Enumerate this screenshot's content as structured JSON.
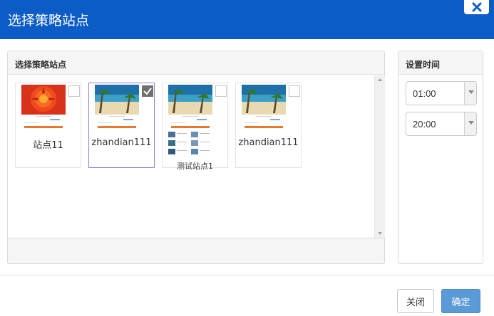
{
  "dialog": {
    "title": "选择策略站点",
    "close_icon": "close-icon"
  },
  "sites_panel": {
    "title": "选择策略站点",
    "sites": [
      {
        "label": "站点11",
        "thumbnail": "flower-thumbnail",
        "checked": false
      },
      {
        "label": "zhandian111",
        "thumbnail": "beach-thumbnail",
        "checked": true
      },
      {
        "label": "测试站点1",
        "thumbnail": "beach-grid-thumbnail",
        "checked": false
      },
      {
        "label": "zhandian111",
        "thumbnail": "beach-thumbnail",
        "checked": false
      }
    ]
  },
  "time_panel": {
    "title": "设置时间",
    "start_time": "01:00",
    "end_time": "20:00"
  },
  "footer": {
    "close_label": "关闭",
    "ok_label": "确定"
  },
  "colors": {
    "header": "#0b5cc7",
    "primary_button": "#5a9ad6",
    "selected_border": "#8a84e0"
  }
}
